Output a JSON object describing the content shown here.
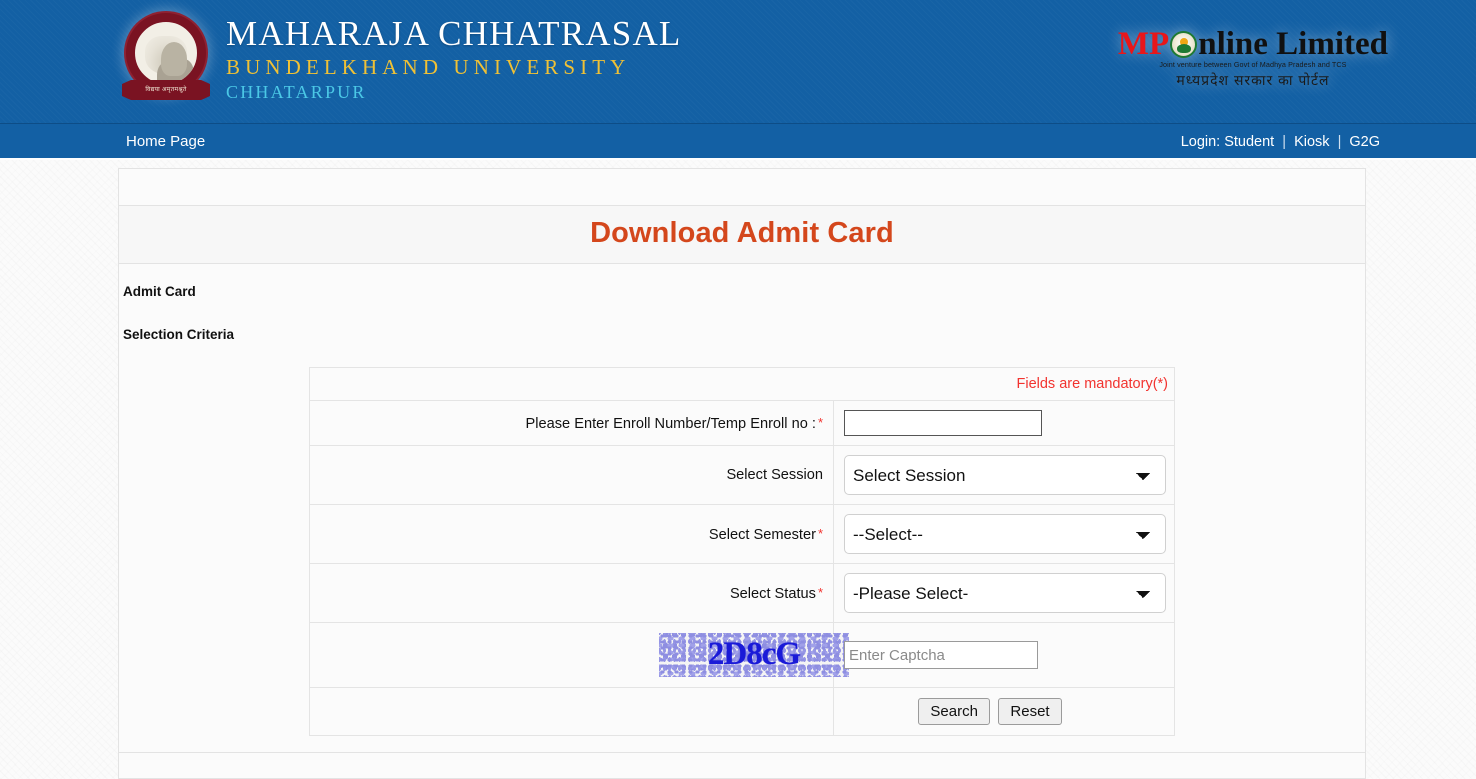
{
  "header": {
    "crest_banner": "विद्यया अमृतमश्नुते",
    "university_name": "MAHARAJA CHHATRASAL",
    "university_sub": "BUNDELKHAND UNIVERSITY",
    "university_city": "CHHATARPUR",
    "partner_logo": {
      "prefix": "MP",
      "o_icon": "mponline-globe-icon",
      "suffix": "nline Limited",
      "tagline": "Joint venture between Govt of Madhya Pradesh and TCS",
      "tagline_hindi": "मध्यप्रदेश सरकार का पोर्टल"
    }
  },
  "navbar": {
    "home": "Home Page",
    "login_label": "Login: Student",
    "kiosk": "Kiosk",
    "g2g": "G2G",
    "separator": "|"
  },
  "page": {
    "title": "Download Admit Card",
    "section_label": "Admit Card",
    "criteria_label": "Selection Criteria"
  },
  "form": {
    "mandatory_note": "Fields are mandatory(*)",
    "rows": [
      {
        "label": "Please Enter Enroll Number/Temp Enroll no :",
        "required": true,
        "value": "",
        "placeholder": ""
      },
      {
        "label": "Select Session",
        "required": false,
        "selected": "Select Session",
        "options": [
          "Select Session"
        ]
      },
      {
        "label": "Select Semester",
        "required": true,
        "selected": "--Select--",
        "options": [
          "--Select--"
        ]
      },
      {
        "label": "Select Status",
        "required": true,
        "selected": "-Please Select-",
        "options": [
          "-Please Select-"
        ]
      }
    ],
    "captcha": {
      "code": "2D8cG",
      "input_value": "",
      "input_placeholder": "Enter Captcha"
    },
    "buttons": {
      "search": "Search",
      "reset": "Reset"
    }
  },
  "colors": {
    "header_blue": "#1360a4",
    "title_orange": "#d4471c",
    "required_red": "#f2332f",
    "brand_yellow": "#f0c135",
    "brand_cyan": "#4bc8e6",
    "captcha_blue": "#1a1ad8"
  }
}
